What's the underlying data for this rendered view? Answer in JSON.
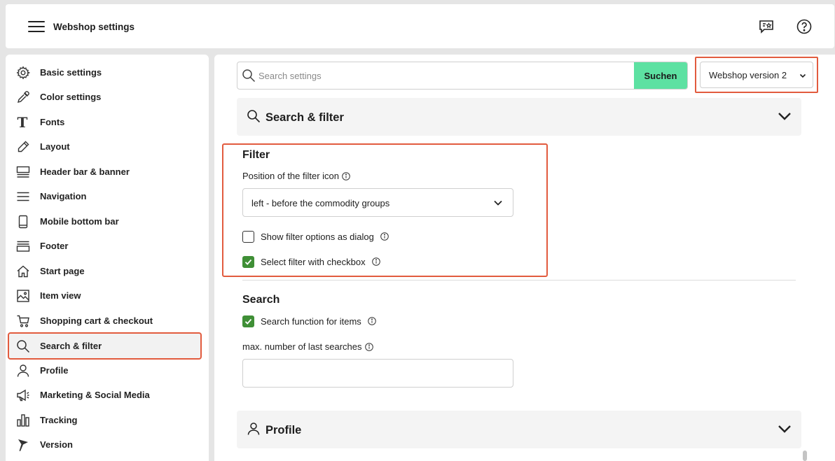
{
  "header": {
    "title": "Webshop settings"
  },
  "sidebar": {
    "items": [
      {
        "label": "Basic settings",
        "icon": "gear-icon"
      },
      {
        "label": "Color settings",
        "icon": "eyedropper-icon"
      },
      {
        "label": "Fonts",
        "icon": "font-icon"
      },
      {
        "label": "Layout",
        "icon": "pencil-icon"
      },
      {
        "label": "Header bar & banner",
        "icon": "header-banner-icon"
      },
      {
        "label": "Navigation",
        "icon": "menu-lines-icon"
      },
      {
        "label": "Mobile bottom bar",
        "icon": "mobile-icon"
      },
      {
        "label": "Footer",
        "icon": "footer-icon"
      },
      {
        "label": "Start page",
        "icon": "home-icon"
      },
      {
        "label": "Item view",
        "icon": "image-icon"
      },
      {
        "label": "Shopping cart & checkout",
        "icon": "cart-icon"
      },
      {
        "label": "Search & filter",
        "icon": "search-icon"
      },
      {
        "label": "Profile",
        "icon": "user-icon"
      },
      {
        "label": "Marketing & Social Media",
        "icon": "megaphone-icon"
      },
      {
        "label": "Tracking",
        "icon": "bar-chart-icon"
      },
      {
        "label": "Version",
        "icon": "flag-icon"
      }
    ],
    "active": "Search & filter"
  },
  "toolbar": {
    "search_placeholder": "Search settings",
    "search_value": "",
    "search_button": "Suchen",
    "version_selected": "Webshop version 2"
  },
  "sections": {
    "search_filter": {
      "title": "Search & filter",
      "filter": {
        "title": "Filter",
        "position_label": "Position of the filter icon",
        "position_value": "left - before the commodity groups",
        "show_dialog_label": "Show filter options as dialog",
        "show_dialog_checked": false,
        "checkbox_label": "Select filter with checkbox",
        "checkbox_checked": true
      },
      "search": {
        "title": "Search",
        "function_label": "Search function for items",
        "function_checked": true,
        "max_label": "max. number of last searches",
        "max_value": ""
      }
    },
    "profile": {
      "title": "Profile"
    }
  },
  "colors": {
    "accent_button": "#5de1a2",
    "highlight": "#e25b3e",
    "checkbox_on": "#3f8f36"
  }
}
